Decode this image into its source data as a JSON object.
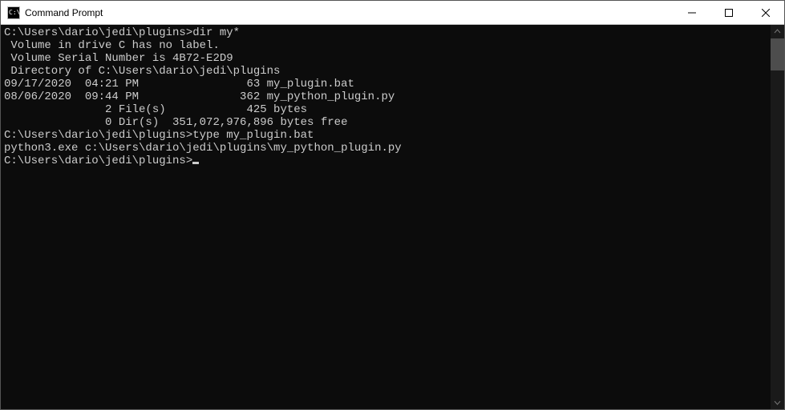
{
  "window": {
    "title": "Command Prompt"
  },
  "terminal": {
    "lines": [
      "",
      "C:\\Users\\dario\\jedi\\plugins>dir my*",
      " Volume in drive C has no label.",
      " Volume Serial Number is 4B72-E2D9",
      "",
      " Directory of C:\\Users\\dario\\jedi\\plugins",
      "",
      "09/17/2020  04:21 PM                63 my_plugin.bat",
      "08/06/2020  09:44 PM               362 my_python_plugin.py",
      "               2 File(s)            425 bytes",
      "               0 Dir(s)  351,072,976,896 bytes free",
      "",
      "C:\\Users\\dario\\jedi\\plugins>type my_plugin.bat",
      "python3.exe c:\\Users\\dario\\jedi\\plugins\\my_python_plugin.py",
      "",
      ""
    ],
    "current_prompt": "C:\\Users\\dario\\jedi\\plugins>"
  }
}
